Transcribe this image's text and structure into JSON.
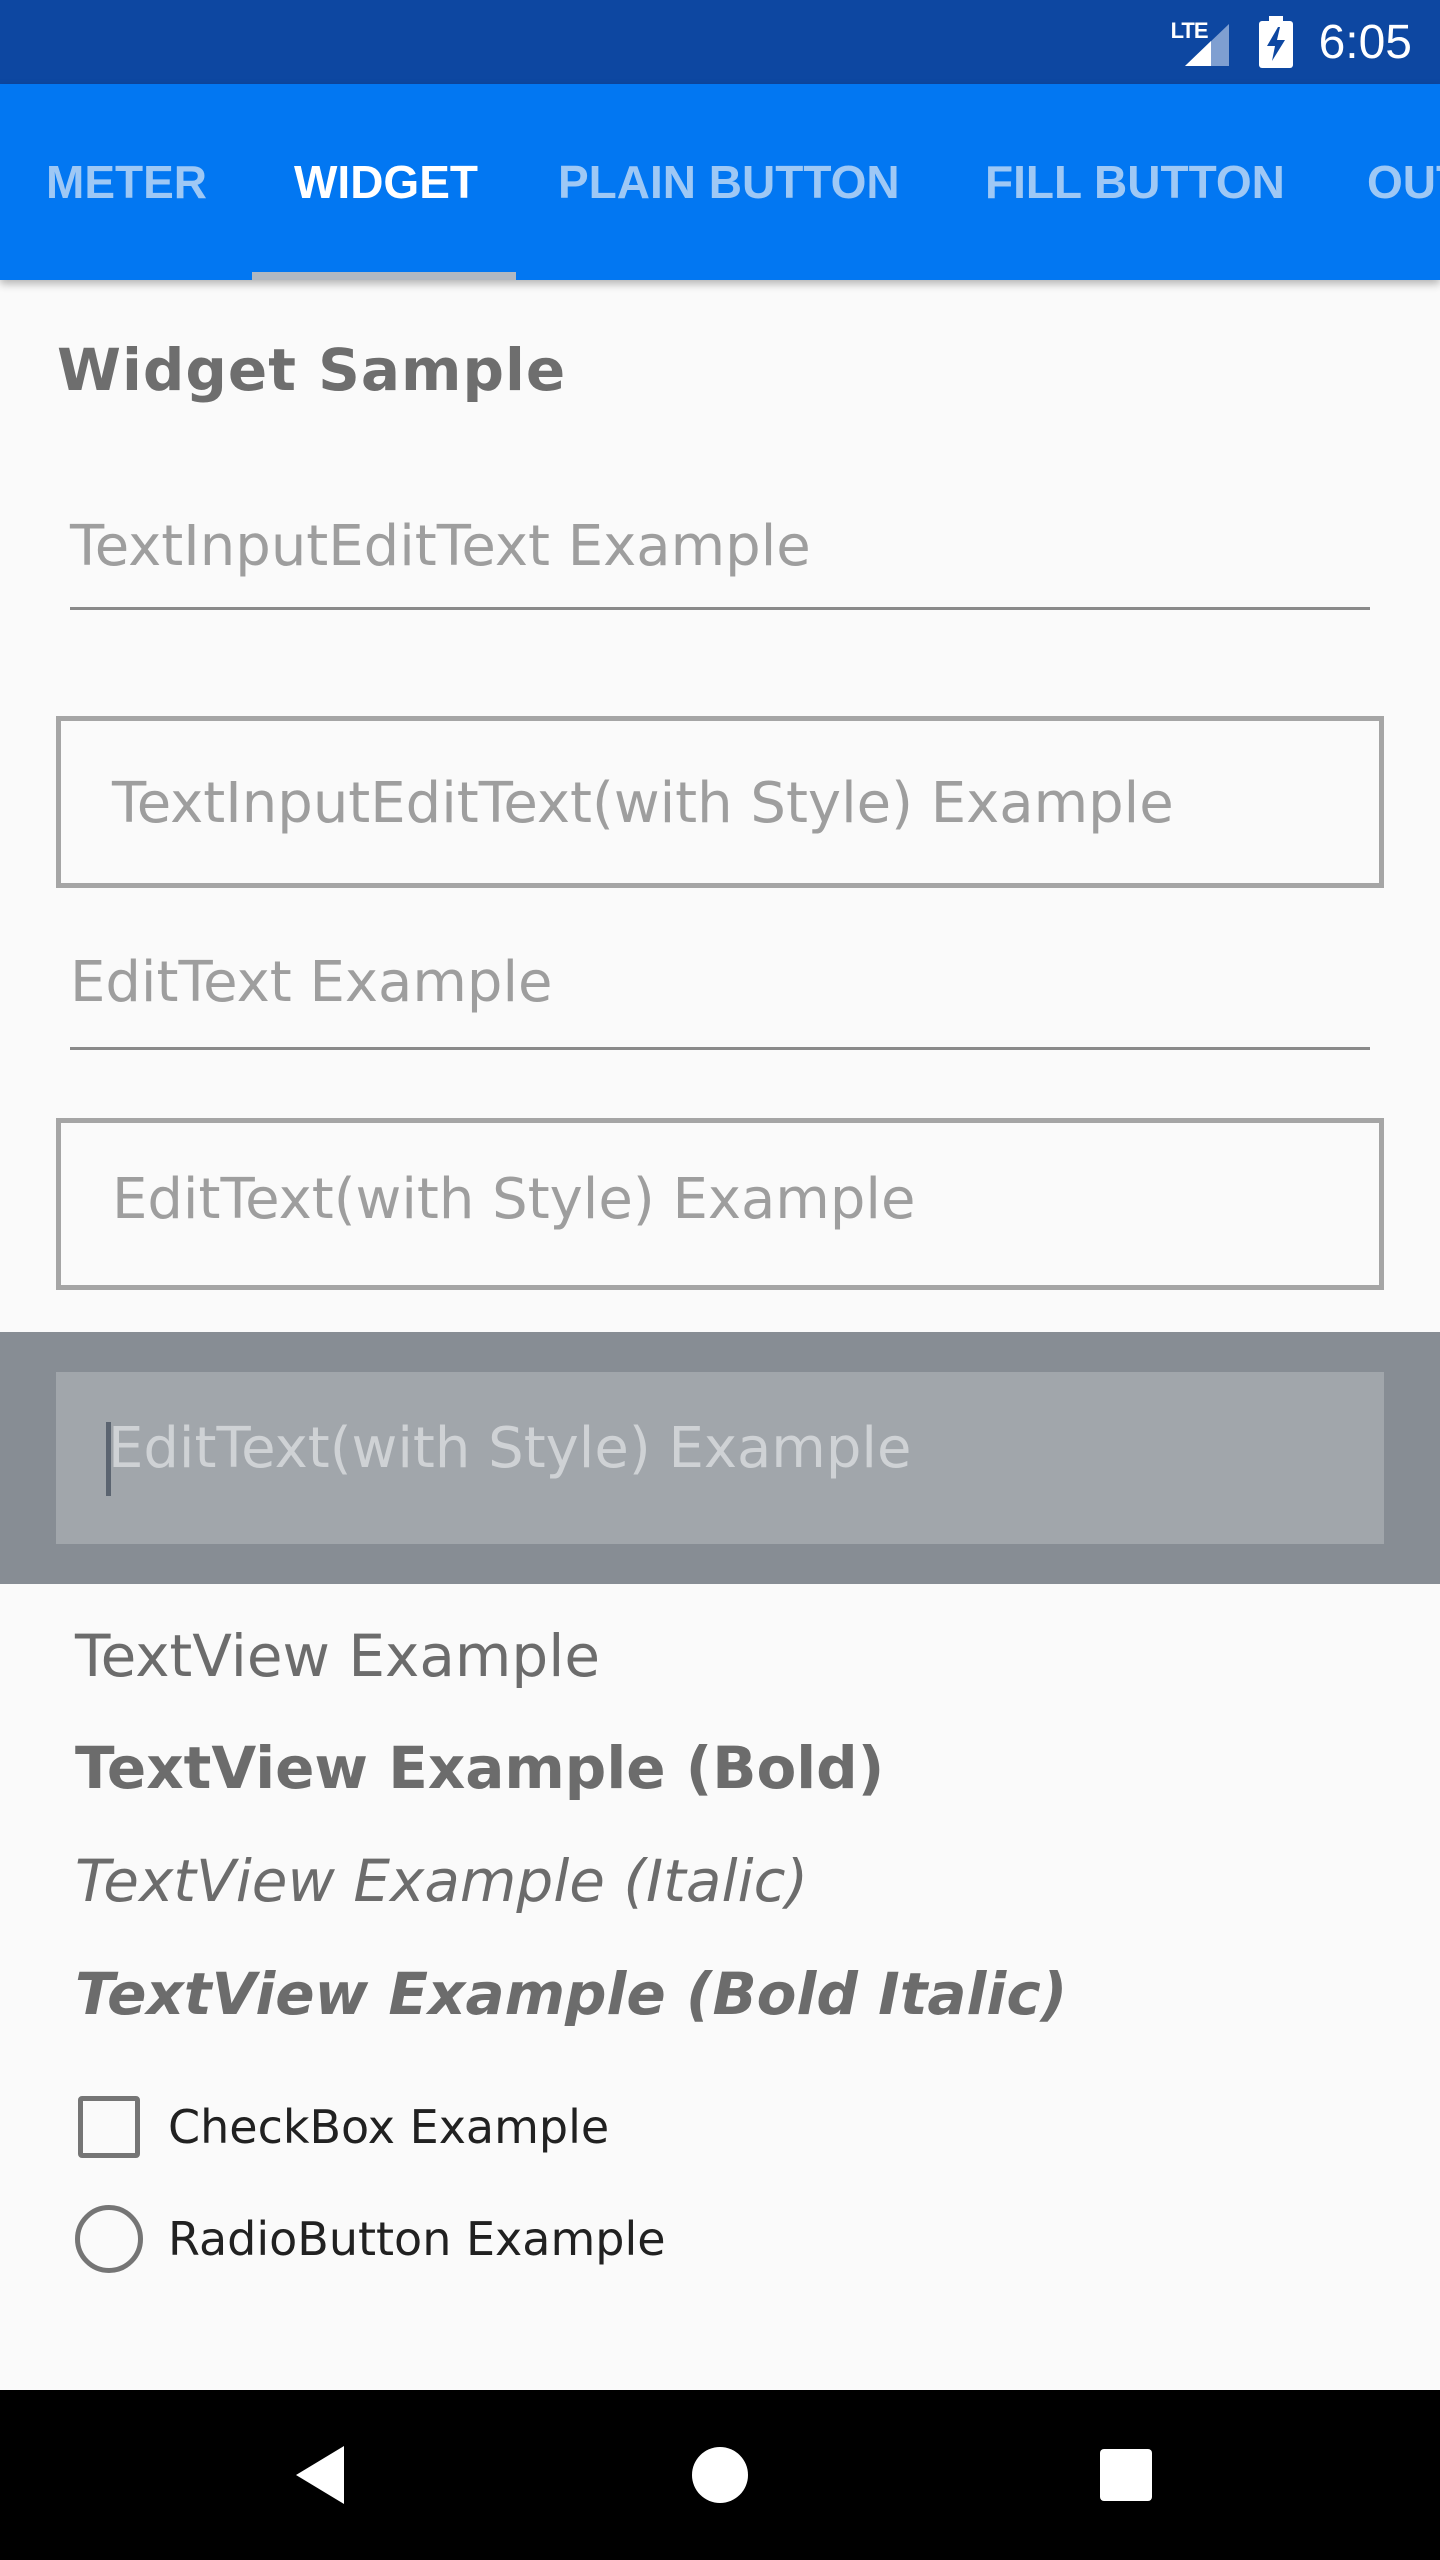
{
  "status_bar": {
    "network": "LTE",
    "time": "6:05",
    "colors": {
      "background": "#0d47a1",
      "foreground": "#ffffff"
    },
    "icons": [
      "lte-signal-icon",
      "battery-charging-icon"
    ]
  },
  "tabs": {
    "items": [
      {
        "label": "METER",
        "active": false
      },
      {
        "label": "WIDGET",
        "active": true
      },
      {
        "label": "PLAIN BUTTON",
        "active": false
      },
      {
        "label": "FILL BUTTON",
        "active": false
      },
      {
        "label": "OUT",
        "active": false
      }
    ],
    "colors": {
      "background": "#0277f2",
      "active": "#ffffff",
      "inactive": "#9ec8f5"
    }
  },
  "content": {
    "title": "Widget Sample",
    "fields": {
      "text_input": {
        "placeholder": "TextInputEditText Example"
      },
      "text_input_styled": {
        "placeholder": "TextInputEditText(with Style) Example"
      },
      "edit_text": {
        "placeholder": "EditText Example"
      },
      "edit_text_styled": {
        "placeholder": "EditText(with Style) Example"
      },
      "edit_text_focused": {
        "placeholder": "EditText(with Style) Example",
        "focused": true
      }
    },
    "text_views": {
      "regular": "TextView Example",
      "bold": "TextView Example (Bold)",
      "italic": "TextView Example (Italic)",
      "bold_italic": "TextView Example (Bold Italic)"
    },
    "checkbox": {
      "label": "CheckBox Example",
      "checked": false
    },
    "radio": {
      "label": "RadioButton Example",
      "selected": false
    }
  },
  "nav_bar": {
    "icons": [
      "back-icon",
      "home-icon",
      "recents-icon"
    ]
  }
}
